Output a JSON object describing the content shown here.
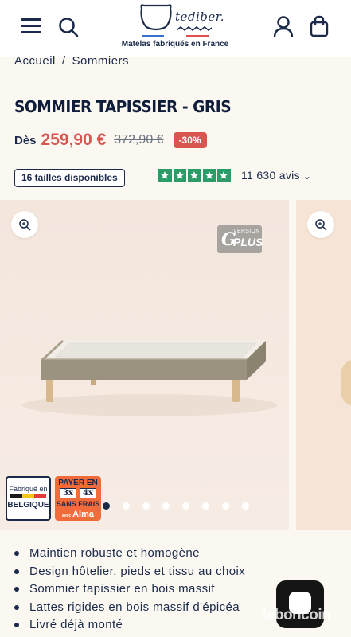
{
  "header": {
    "logo_word": "tediber.",
    "logo_tagline": "Matelas fabriqués en France",
    "menu_icon": "hamburger-menu-icon",
    "search_icon": "search-icon",
    "account_icon": "user-icon",
    "cart_icon": "shopping-bag-icon"
  },
  "breadcrumb": {
    "home": "Accueil",
    "separator": "/",
    "current": "Sommiers"
  },
  "product": {
    "title": "SOMMIER TAPISSIER - GRIS",
    "price_prefix": "Dès",
    "price": "259,90 €",
    "old_price": "372,90 €",
    "discount": "-30%",
    "sizes": "16 tailles disponibles",
    "rating_stars": 5,
    "reviews": "11 630 avis",
    "accent_color": "#d95550",
    "rating_color": "#2b9b67"
  },
  "gallery": {
    "version_small": "VERSION",
    "version_big": "PLUS",
    "badge_made_in": "Fabriqué en",
    "badge_country": "BELGIQUE",
    "alma_line1": "PAYER EN",
    "alma_option1": "3x",
    "alma_option2": "4x",
    "alma_line3": "SANS FRAIS",
    "alma_avec": "avec",
    "alma_brand": "Alma",
    "slide_count": 8,
    "active_slide": 1
  },
  "features": [
    "Maintien robuste et homogène",
    "Design hôtelier, pieds et tissu au choix",
    "Sommier tapissier en bois massif",
    "Lattes rigides en bois massif d'épicéa",
    "Livré déjà monté"
  ],
  "watermark": "leboncoin"
}
